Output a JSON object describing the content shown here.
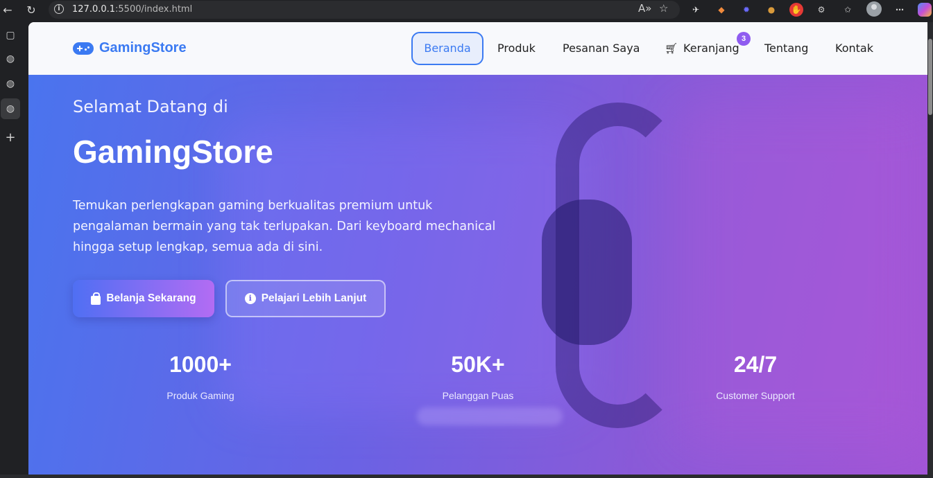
{
  "browser": {
    "url_host": "127.0.0.1",
    "url_rest": ":5500/index.html",
    "icons": [
      "back-icon",
      "refresh-icon",
      "info-icon",
      "read-aloud-icon",
      "favorite-star-icon",
      "extension-icon",
      "favorites-icon",
      "more-icon"
    ]
  },
  "nav": {
    "brand": "GamingStore",
    "items": [
      {
        "label": "Beranda",
        "active": true
      },
      {
        "label": "Produk"
      },
      {
        "label": "Pesanan Saya"
      },
      {
        "label": "Keranjang"
      },
      {
        "label": "Tentang"
      },
      {
        "label": "Kontak"
      }
    ],
    "cart_count": "3"
  },
  "hero": {
    "greeting": "Selamat Datang di",
    "title": "GamingStore",
    "description": "Temukan perlengkapan gaming berkualitas premium untuk pengalaman bermain yang tak terlupakan. Dari keyboard mechanical hingga setup lengkap, semua ada di sini.",
    "primary_button": "Belanja Sekarang",
    "secondary_button": "Pelajari Lebih Lanjut"
  },
  "stats": [
    {
      "value": "1000+",
      "label": "Produk Gaming"
    },
    {
      "value": "50K+",
      "label": "Pelanggan Puas"
    },
    {
      "value": "24/7",
      "label": "Customer Support"
    }
  ],
  "colors": {
    "brand": "#3b7af2",
    "badge": "#8f5cf0",
    "hero_start": "#4a74ee",
    "hero_end": "#a155d6"
  }
}
